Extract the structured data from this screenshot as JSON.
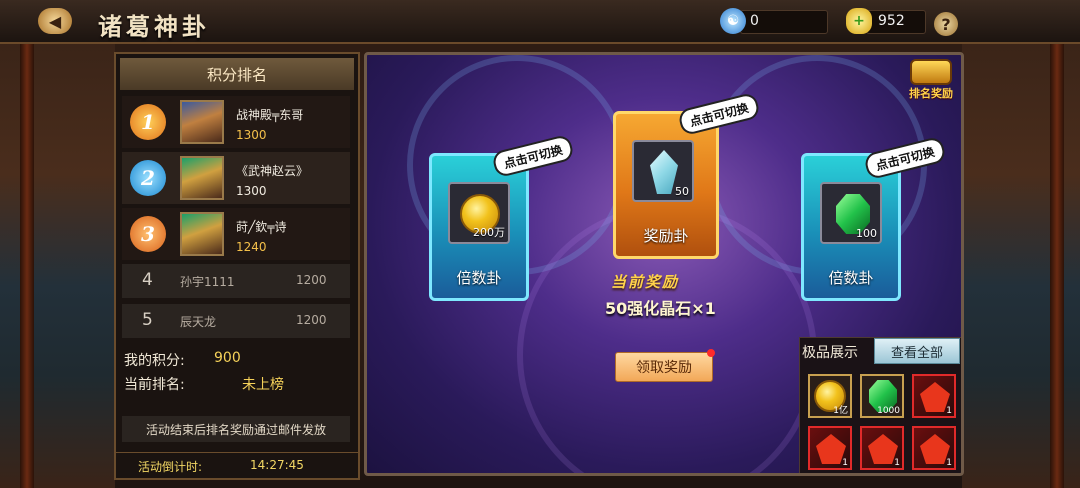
{
  "header": {
    "back_glyph": "◀",
    "title": "诸葛神卦",
    "currency1_icon": "taiji-icon",
    "currency1_value": "0",
    "currency2_icon": "gold-ingot-icon",
    "currency2_value": "952",
    "help_glyph": "?"
  },
  "ranking": {
    "title": "积分排名",
    "top": [
      {
        "rank": "1",
        "name": "战神殿╤东哥",
        "score": "1300",
        "medal_color": "#e8781a"
      },
      {
        "rank": "2",
        "name": "《武神赵云》",
        "score": "1300",
        "medal_color": "#2aa8e0"
      },
      {
        "rank": "3",
        "name": "莳╱欽╤诗",
        "score": "1240",
        "medal_color": "#e8781a"
      }
    ],
    "others": [
      {
        "rank": "4",
        "name": "孙宇1111",
        "score": "1200"
      },
      {
        "rank": "5",
        "name": "辰天龙",
        "score": "1200"
      }
    ],
    "my_score_label": "我的积分:",
    "my_score_value": "900",
    "my_rank_label": "当前排名:",
    "my_rank_value": "未上榜",
    "notice": "活动结束后排名奖励通过邮件发放",
    "countdown_label": "活动倒计时:",
    "countdown_value": "14:27:45"
  },
  "main": {
    "rank_reward_label": "排名奖励",
    "cards": [
      {
        "name": "倍数卦",
        "qty": "200万",
        "bubble": "点击可切换",
        "item_icon": "gold-coin-icon"
      },
      {
        "name": "奖励卦",
        "qty": "50",
        "bubble": "点击可切换",
        "item_icon": "crystal-icon"
      },
      {
        "name": "倍数卦",
        "qty": "100",
        "bubble": "点击可切换",
        "item_icon": "emerald-icon"
      }
    ],
    "current_reward_label": "当前奖励",
    "current_reward_item": "50强化晶石×1",
    "claim_button": "领取奖励"
  },
  "showcase": {
    "title": "极品展示",
    "view_all": "查看全部",
    "items": [
      {
        "icon": "gold-coin-icon",
        "qty": "1亿"
      },
      {
        "icon": "emerald-icon",
        "qty": "1000"
      },
      {
        "icon": "red-fragment-icon",
        "qty": "1"
      },
      {
        "icon": "red-fragment-icon",
        "qty": "1"
      },
      {
        "icon": "red-fragment-icon",
        "qty": "1"
      },
      {
        "icon": "red-fragment-icon",
        "qty": "1"
      }
    ]
  }
}
